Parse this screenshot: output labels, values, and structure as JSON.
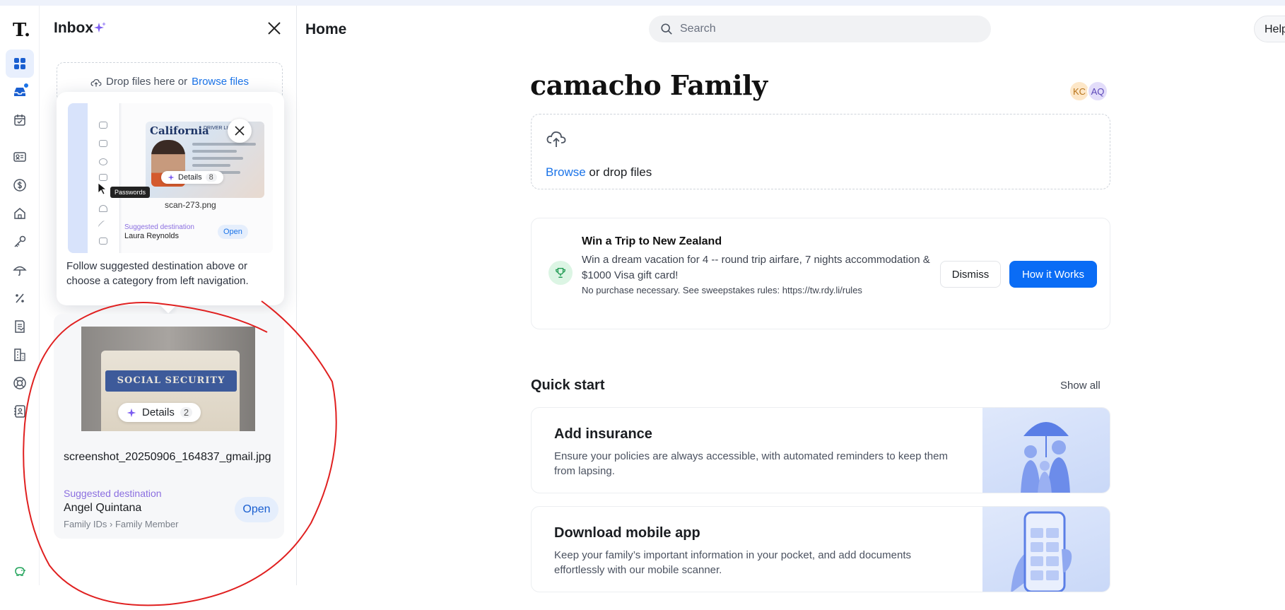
{
  "app": {
    "logo": "T."
  },
  "rail": {
    "items": [
      "dashboard",
      "inbox",
      "calendar",
      "id-card",
      "dollar",
      "home",
      "key",
      "umbrella",
      "percent",
      "document",
      "building",
      "lifebuoy",
      "contacts",
      "piggy-bank"
    ]
  },
  "inbox": {
    "title": "Inbox",
    "dropzone": {
      "text": "Drop files here or",
      "link": "Browse files"
    },
    "tip": {
      "preview": {
        "state": "California",
        "license_label": "DRIVER LICENSE",
        "details_label": "Details",
        "details_count": "8",
        "filename": "scan-273.png",
        "suggested": "Suggested destination",
        "person": "Laura Reynolds",
        "open": "Open",
        "tooltip": "Passwords"
      },
      "text": "Follow suggested destination above or choose a category from left navigation."
    },
    "doc": {
      "card_text": "SOCIAL SECURITY",
      "details_label": "Details",
      "details_count": "2",
      "filename": "screenshot_20250906_164837_gmail.jpg",
      "suggested": "Suggested destination",
      "person": "Angel Quintana",
      "path": "Family IDs › Family Member",
      "open": "Open"
    }
  },
  "header": {
    "title": "Home",
    "search_placeholder": "Search",
    "help": "Help"
  },
  "main": {
    "family_title": "camacho Family",
    "avatars": [
      "KC",
      "AQ"
    ],
    "upload": {
      "link": "Browse",
      "text": "or drop files"
    },
    "promo": {
      "title": "Win a Trip to New Zealand",
      "desc": "Win a dream vacation for 4 -- round trip airfare, 7 nights accommodation & $1000 Visa gift card!",
      "rules": "No purchase necessary. See sweepstakes rules: https://tw.rdy.li/rules",
      "dismiss": "Dismiss",
      "how": "How it Works"
    },
    "quick_start": {
      "title": "Quick start",
      "show_all": "Show all",
      "cards": [
        {
          "title": "Add insurance",
          "desc": "Ensure your policies are always accessible, with automated reminders to keep them from lapsing."
        },
        {
          "title": "Download mobile app",
          "desc": "Keep your family’s important information in your pocket, and add documents effortlessly with our mobile scanner."
        }
      ]
    }
  },
  "colors": {
    "accent": "#0a6cf5",
    "link": "#1a73e8",
    "suggested": "#8b6fe0",
    "annotation": "#e02020"
  }
}
